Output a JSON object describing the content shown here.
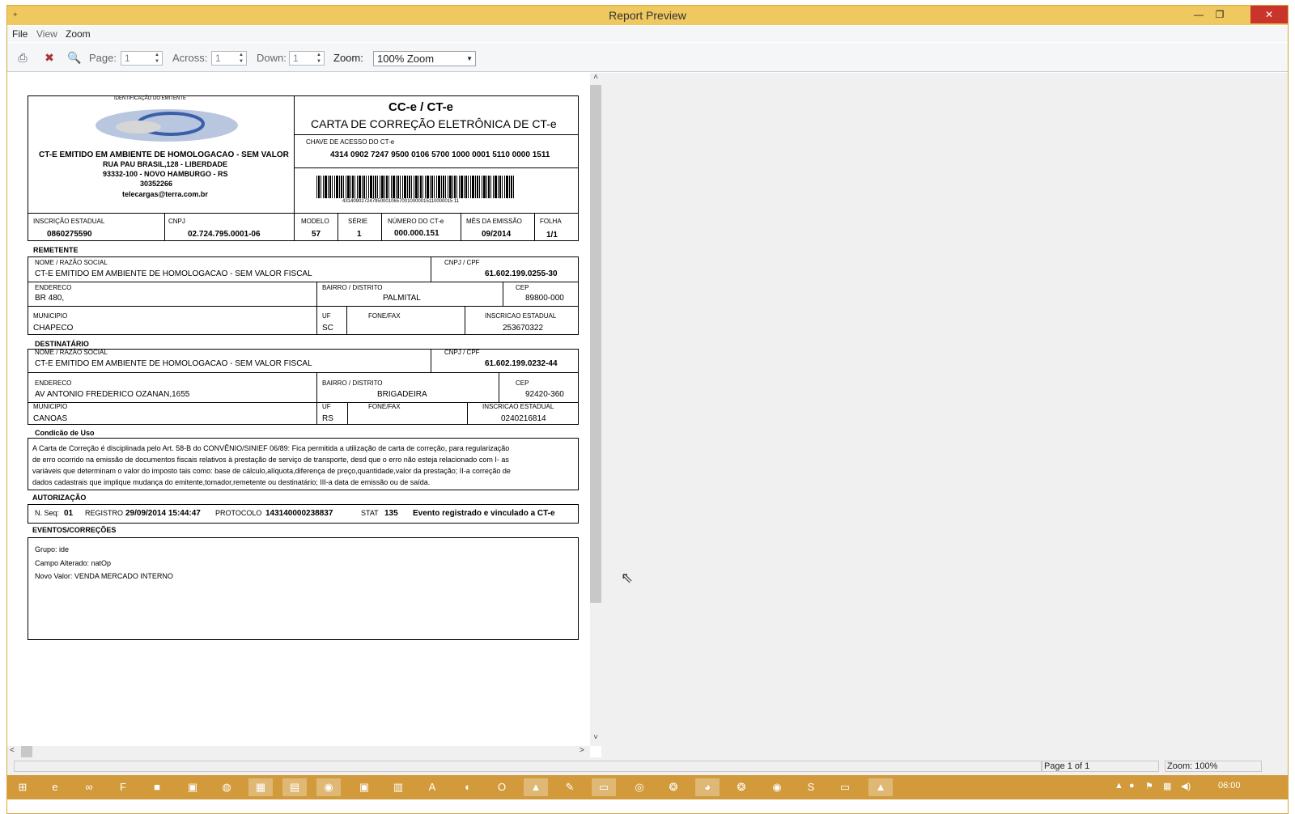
{
  "window": {
    "title": "Report Preview"
  },
  "menu": {
    "file": "File",
    "view": "View",
    "zoom": "Zoom"
  },
  "toolbar": {
    "page_label": "Page:",
    "page_value": "1",
    "across_label": "Across:",
    "across_value": "1",
    "down_label": "Down:",
    "down_value": "1",
    "zoom_label": "Zoom:",
    "zoom_value": "100% Zoom"
  },
  "status": {
    "page": "Page 1 of 1",
    "zoom": "Zoom: 100%"
  },
  "clock": "06:00",
  "report": {
    "emitente_label": "IDENTIFICAÇÃO DO EMITENTE",
    "emitente_name": "CT-E EMITIDO EM AMBIENTE DE HOMOLOGACAO - SEM VALOR",
    "emitente_addr1": "RUA PAU BRASIL,128 - LIBERDADE",
    "emitente_addr2": "93332-100 - NOVO HAMBURGO - RS",
    "emitente_phone": "30352266",
    "emitente_email": "telecargas@terra.com.br",
    "doc_title": "CC-e / CT-e",
    "doc_subtitle": "CARTA DE CORREÇÃO ELETRÔNICA DE CT-e",
    "chave_label": "CHAVE DE ACESSO DO CT-e",
    "chave_value": "4314 0902 7247 9500 0106 5700 1000 0001 5110 0000 1511",
    "barcode_text": "43140902724795000106570010000015110000015 11",
    "ie_label": "INSCRIÇÃO ESTADUAL",
    "ie_value": "0860275590",
    "cnpj_label": "CNPJ",
    "cnpj_value": "02.724.795.0001-06",
    "modelo_label": "MODELO",
    "modelo_value": "57",
    "serie_label": "SÉRIE",
    "serie_value": "1",
    "numero_label": "NÚMERO DO CT-e",
    "numero_value": "000.000.151",
    "mes_label": "MÊS DA EMISSÃO",
    "mes_value": "09/2014",
    "folha_label": "FOLHA",
    "folha_value": "1/1",
    "remetente": {
      "section": "REMETENTE",
      "nome_label": "NOME / RAZÃO SOCIAL",
      "nome_value": "CT-E EMITIDO EM AMBIENTE DE HOMOLOGACAO - SEM VALOR FISCAL",
      "cnpj_label": "CNPJ / CPF",
      "cnpj_value": "61.602.199.0255-30",
      "end_label": "ENDERECO",
      "end_value": "BR 480,",
      "bairro_label": "BAIRRO / DISTRITO",
      "bairro_value": "PALMITAL",
      "cep_label": "CEP",
      "cep_value": "89800-000",
      "mun_label": "MUNICIPIO",
      "mun_value": "CHAPECO",
      "uf_label": "UF",
      "uf_value": "SC",
      "fone_label": "FONE/FAX",
      "ie_label": "INSCRICAO ESTADUAL",
      "ie_value": "253670322"
    },
    "destinatario": {
      "section": "DESTINATÁRIO",
      "nome_label": "NOME / RAZÃO SOCIAL",
      "nome_value": "CT-E EMITIDO EM AMBIENTE DE HOMOLOGACAO - SEM VALOR FISCAL",
      "cnpj_label": "CNPJ / CPF",
      "cnpj_value": "61.602.199.0232-44",
      "end_label": "ENDERECO",
      "end_value": "AV ANTONIO FREDERICO OZANAN,1655",
      "bairro_label": "BAIRRO / DISTRITO",
      "bairro_value": "BRIGADEIRA",
      "cep_label": "CEP",
      "cep_value": "92420-360",
      "mun_label": "MUNICIPIO",
      "mun_value": "CANOAS",
      "uf_label": "UF",
      "uf_value": "RS",
      "fone_label": "FONE/FAX",
      "ie_label": "INSCRICAO ESTADUAL",
      "ie_value": "0240216814"
    },
    "condicao_label": "Condicão de Uso",
    "condicao_lines": [
      "A Carta de Correção é disciplinada pelo Art. 58-B do CONVÊNIO/SINIEF 06/89: Fica permitida a utilização de carta de correção, para regularização",
      "de erro ocorrido na emissão de documentos fiscais relativos à prestação de serviço de transporte, desd que o erro não esteja relacionado com I- as",
      "variáveis que determinam o valor do imposto tais como: base de cálculo,alíquota,diferença de preço,quantidade,valor da prestação; II-a correção de",
      "dados cadastrais que implique mudança do emitente,tomador,remetente ou destinatário; III-a data de emissão ou de saída."
    ],
    "autorizacao_label": "AUTORIZAÇÃO",
    "nseq_label": "N. Seq:",
    "nseq_value": "01",
    "registro_label": "REGISTRO",
    "registro_value": "29/09/2014 15:44:47",
    "protocolo_label": "PROTOCOLO",
    "protocolo_value": "143140000238837",
    "stat_label": "STAT",
    "stat_value": "135",
    "evento_text": "Evento registrado e vinculado a CT-e",
    "eventos_label": "EVENTOS/CORREÇÕES",
    "eventos_lines": [
      "Grupo: ide",
      "Campo Alterado: natOp",
      "Novo Valor: VENDA MERCADO INTERNO"
    ]
  }
}
